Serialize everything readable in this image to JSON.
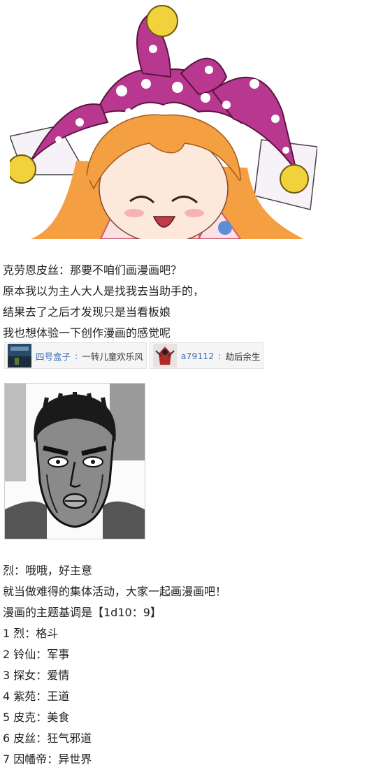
{
  "post1": {
    "lines": [
      "克劳恩皮丝：那要不咱们画漫画吧？",
      "原本我以为主人大人是找我去当助手的，",
      "结果去了之后才发现只是当看板娘",
      "我也想体验一下创作漫画的感觉呢"
    ]
  },
  "quotes": [
    {
      "user": "四号盒子",
      "sep": ": ",
      "title": "一转儿童欢乐风",
      "icon": "sky-thumbnail-icon"
    },
    {
      "user": "a79112",
      "sep": ": ",
      "title": "劫后余生",
      "icon": "red-figure-thumbnail-icon"
    }
  ],
  "post2": {
    "lines": [
      "烈：哦哦，好主意",
      "就当做难得的集体活动，大家一起画漫画吧！",
      "漫画的主题基调是【1d10：9】",
      "1 烈：格斗",
      "2 铃仙：军事",
      "3 探女：爱情",
      "4 紫苑：王道",
      "5 皮克：美食",
      "6 皮丝：狂气邪道",
      "7 因幡帝：异世界"
    ]
  },
  "colors": {
    "hat_magenta": "#b8388f",
    "pom_yellow": "#f2d23c",
    "hair_orange": "#f4a042",
    "link_blue": "#3a6fb0"
  }
}
